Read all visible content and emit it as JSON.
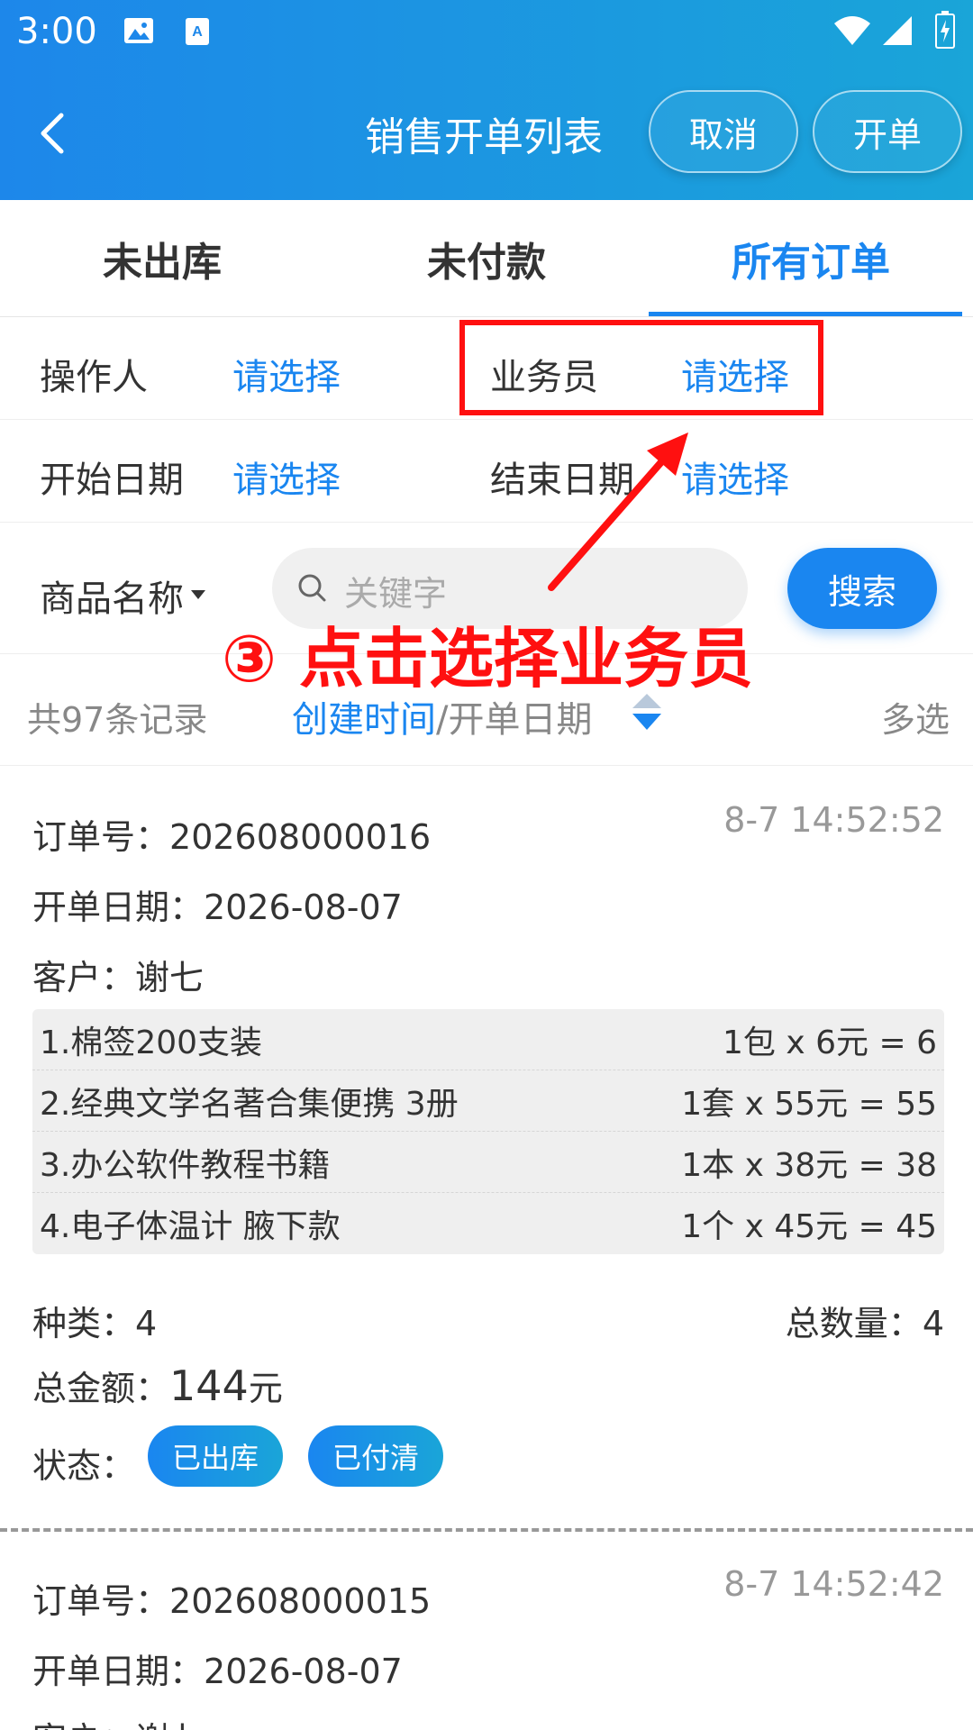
{
  "status_bar": {
    "time": "3:00"
  },
  "header": {
    "title": "销售开单列表",
    "cancel_label": "取消",
    "open_label": "开单"
  },
  "tabs": [
    {
      "label": "未出库",
      "active": false
    },
    {
      "label": "未付款",
      "active": false
    },
    {
      "label": "所有订单",
      "active": true
    }
  ],
  "filters": {
    "operator_label": "操作人",
    "operator_value": "请选择",
    "salesman_label": "业务员",
    "salesman_value": "请选择",
    "start_label": "开始日期",
    "start_value": "请选择",
    "end_label": "结束日期",
    "end_value": "请选择"
  },
  "search": {
    "field_label": "商品名称",
    "placeholder": "关键字",
    "button_label": "搜索"
  },
  "records": {
    "count_text": "共97条记录",
    "sort_active": "创建时间",
    "sort_sep": "/",
    "sort_other": "开单日期",
    "multi_label": "多选"
  },
  "orders": [
    {
      "no_label": "订单号：",
      "no": "202608000016",
      "time": "8-7 14:52:52",
      "date_label": "开单日期：",
      "date": "2026-08-07",
      "customer_label": "客户：",
      "customer": "谢七",
      "items": [
        {
          "name": "1.棉签200支装",
          "calc": "1包 x 6元 = 6"
        },
        {
          "name": "2.经典文学名著合集便携 3册",
          "calc": "1套 x 55元 = 55"
        },
        {
          "name": "3.办公软件教程书籍",
          "calc": "1本 x 38元 = 38"
        },
        {
          "name": "4.电子体温计 腋下款",
          "calc": "1个 x 45元 = 45"
        }
      ],
      "kinds_label": "种类：",
      "kinds": "4",
      "qty_label": "总数量：",
      "qty": "4",
      "amount_label": "总金额：",
      "amount": "144",
      "amount_unit": "元",
      "status_label": "状态：",
      "status": [
        "已出库",
        "已付清"
      ]
    },
    {
      "no_label": "订单号：",
      "no": "202608000015",
      "time": "8-7 14:52:42",
      "date_label": "开单日期：",
      "date": "2026-08-07",
      "customer_label": "客户：",
      "customer": "谢七"
    }
  ],
  "annotation": {
    "text": "③ 点击选择业务员",
    "color": "#ff1010"
  },
  "colors": {
    "accent": "#1a86f0",
    "header_start": "#1d87ea",
    "header_end": "#1aa5d8"
  }
}
